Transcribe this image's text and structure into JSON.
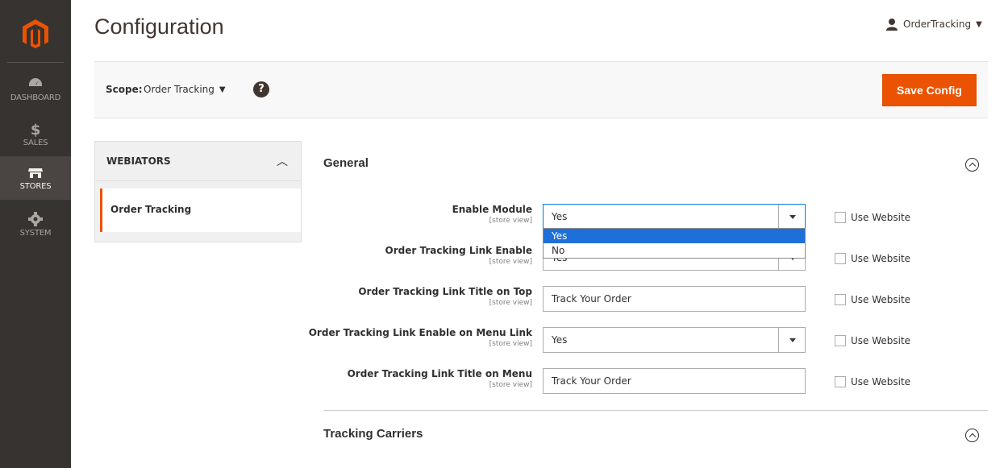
{
  "sidebar": {
    "items": [
      {
        "label": "DASHBOARD",
        "icon": "dashboard-icon"
      },
      {
        "label": "SALES",
        "icon": "dollar-icon"
      },
      {
        "label": "STORES",
        "icon": "store-icon",
        "active": true
      },
      {
        "label": "SYSTEM",
        "icon": "gear-icon"
      }
    ]
  },
  "header": {
    "title": "Configuration",
    "user": "OrderTracking"
  },
  "scope": {
    "label": "Scope:",
    "value": "Order Tracking",
    "help": "?",
    "save_label": "Save Config"
  },
  "tabs": {
    "group_title": "WEBIATORS",
    "items": [
      {
        "label": "Order Tracking"
      }
    ]
  },
  "sections": {
    "general": {
      "title": "General",
      "fields": [
        {
          "label": "Enable Module",
          "scope": "[store view]",
          "value": "Yes",
          "type": "select",
          "use_website": "Use Website"
        },
        {
          "label": "Order Tracking Link Enable",
          "scope": "[store view]",
          "value": "Yes",
          "type": "select",
          "use_website": "Use Website"
        },
        {
          "label": "Order Tracking Link Title on Top",
          "scope": "[store view]",
          "value": "Track Your Order",
          "type": "text",
          "use_website": "Use Website"
        },
        {
          "label": "Order Tracking Link Enable on Menu Link",
          "scope": "[store view]",
          "value": "Yes",
          "type": "select",
          "use_website": "Use Website"
        },
        {
          "label": "Order Tracking Link Title on Menu",
          "scope": "[store view]",
          "value": "Track Your Order",
          "type": "text",
          "use_website": "Use Website"
        }
      ]
    },
    "tracking_carriers": {
      "title": "Tracking Carriers"
    }
  },
  "dropdown": {
    "options": [
      "Yes",
      "No"
    ],
    "selected": "Yes"
  },
  "colors": {
    "accent": "#eb5202",
    "sidebar_bg": "#373330",
    "dropdown_highlight": "#1e70d8"
  }
}
